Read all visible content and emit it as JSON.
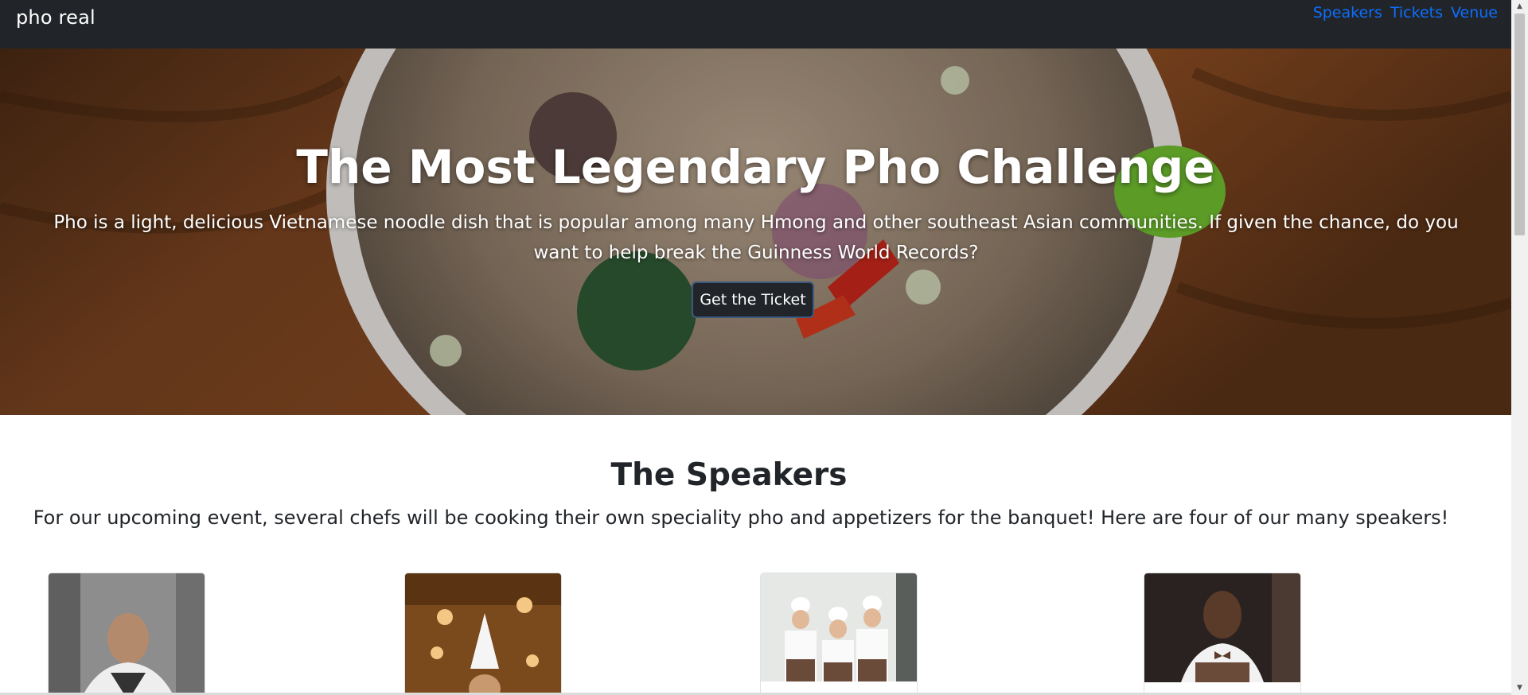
{
  "navbar": {
    "brand": "pho real",
    "links": [
      "Speakers",
      "Tickets",
      "Venue"
    ]
  },
  "hero": {
    "title": "The Most Legendary Pho Challenge",
    "text": "Pho is a light, delicious Vietnamese noodle dish that is popular among many Hmong and other southeast Asian communities. If given the chance, do you want to help break the Guinness World Records?",
    "button": "Get the Ticket"
  },
  "speakers": {
    "title": "The Speakers",
    "text": "For our upcoming event, several chefs will be cooking their own speciality pho and appetizers for the banquet! Here are four of our many speakers!"
  },
  "colors": {
    "navbar": "#212529",
    "link": "#0d6efd",
    "button": "#212529"
  }
}
